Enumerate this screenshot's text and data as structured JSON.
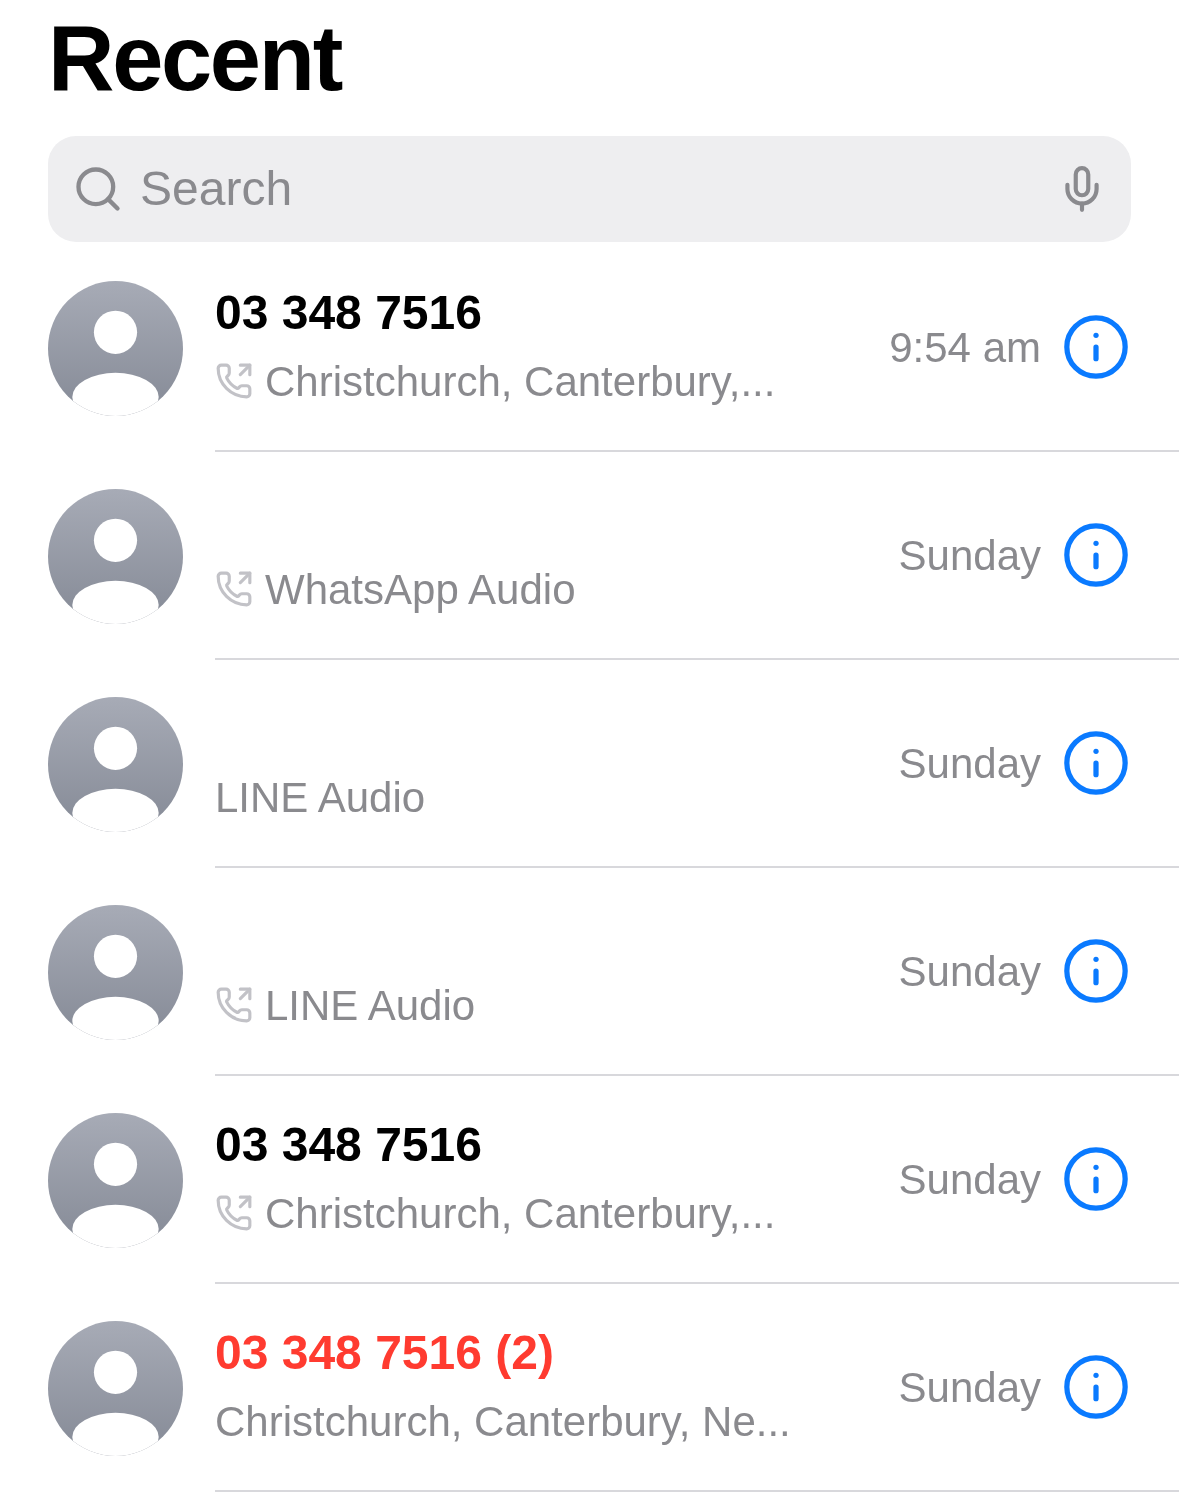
{
  "title": "Recent",
  "search": {
    "placeholder": "Search"
  },
  "calls": [
    {
      "name": "03 348 7516",
      "missed": false,
      "outgoing": true,
      "subtitle": "Christchurch, Canterbury,...",
      "time": "9:54 am"
    },
    {
      "outgoing": true,
      "subtitle": "WhatsApp Audio",
      "time": "Sunday"
    },
    {
      "outgoing": false,
      "subtitle": "LINE Audio",
      "time": "Sunday"
    },
    {
      "outgoing": true,
      "subtitle": "LINE Audio",
      "time": "Sunday"
    },
    {
      "name": "03 348 7516",
      "missed": false,
      "outgoing": true,
      "subtitle": "Christchurch, Canterbury,...",
      "time": "Sunday"
    },
    {
      "name": "03 348 7516 (2)",
      "missed": true,
      "outgoing": false,
      "subtitle": "Christchurch, Canterbury, Ne...",
      "time": "Sunday"
    }
  ]
}
